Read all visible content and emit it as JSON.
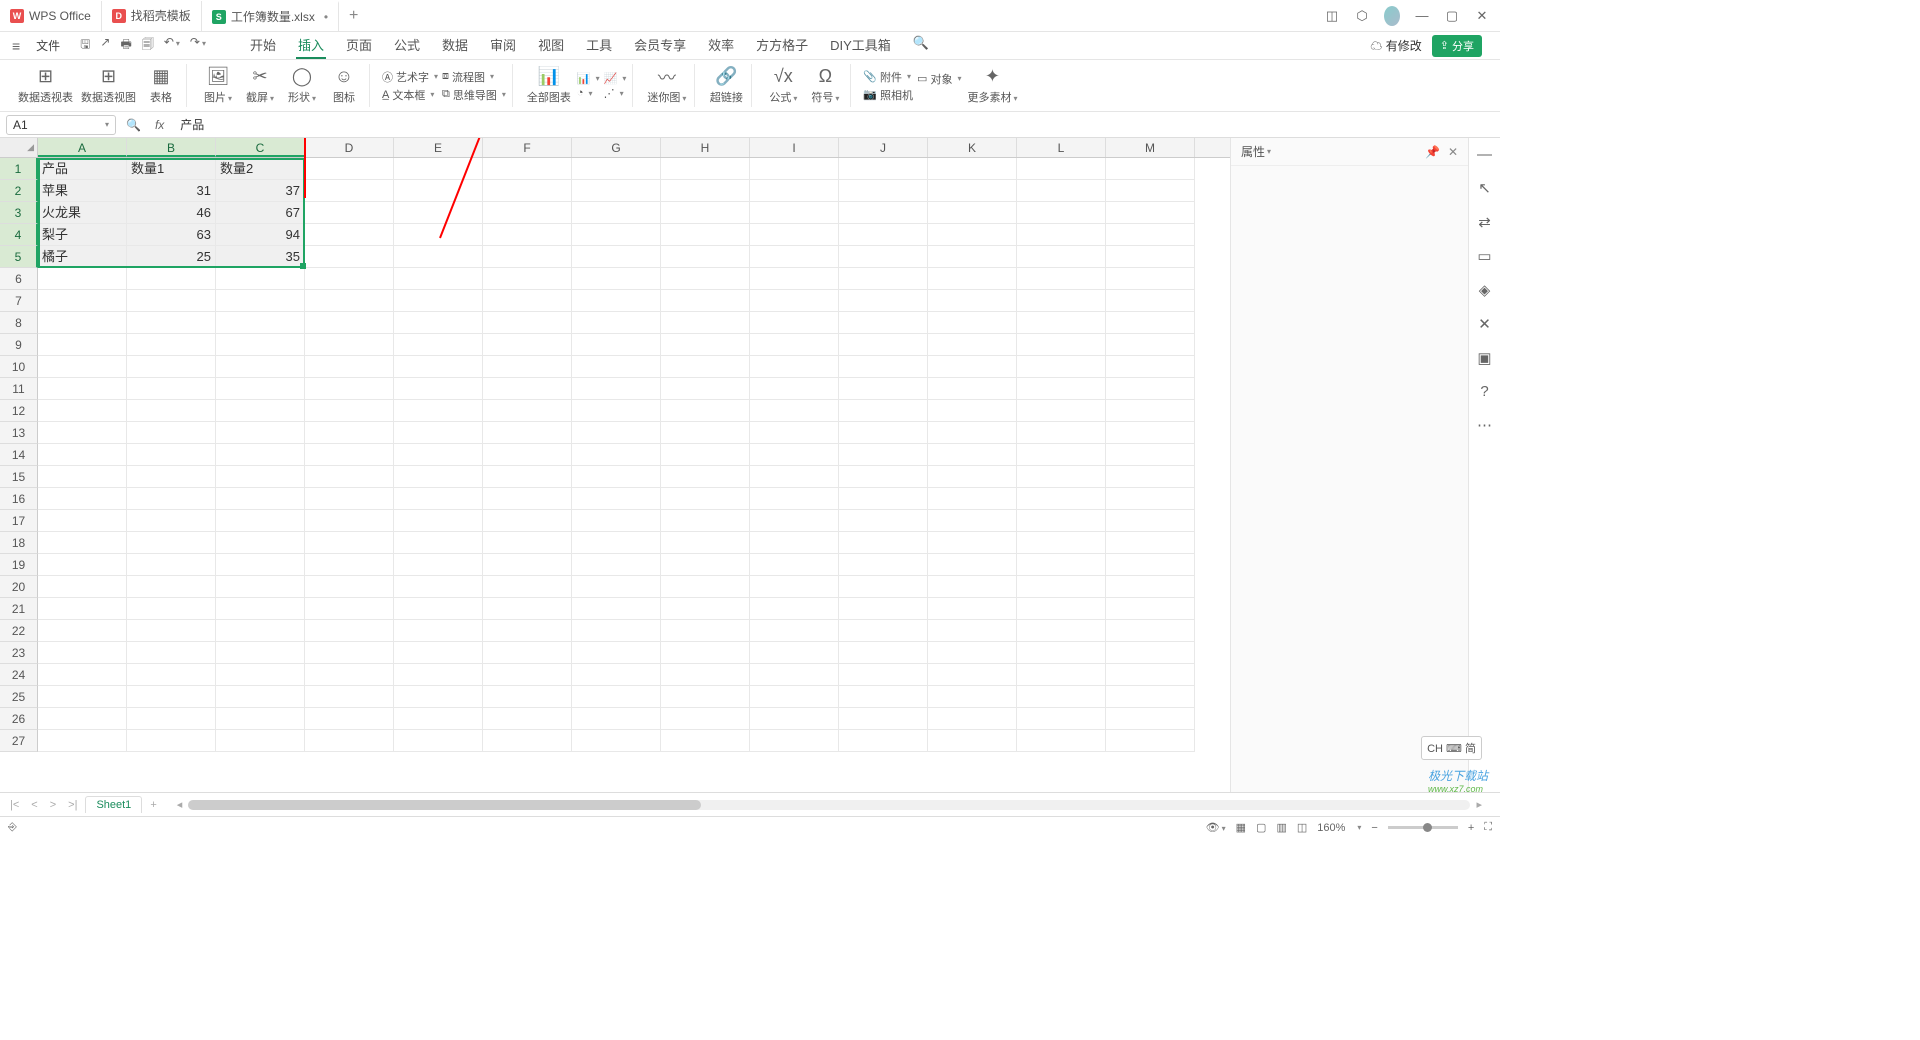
{
  "tabs": [
    {
      "label": "WPS Office",
      "icon": "red"
    },
    {
      "label": "找稻壳模板",
      "icon": "redfill"
    },
    {
      "label": "工作簿数量.xlsx",
      "icon": "green",
      "dirty": "•"
    }
  ],
  "file_menu": "文件",
  "menu_tabs": [
    "开始",
    "插入",
    "页面",
    "公式",
    "数据",
    "审阅",
    "视图",
    "工具",
    "会员专享",
    "效率",
    "方方格子",
    "DIY工具箱"
  ],
  "menu_active_index": 1,
  "header_right": {
    "revise": "有修改",
    "share": "分享"
  },
  "ribbon": {
    "g1": [
      "数据透视表",
      "数据透视图",
      "表格"
    ],
    "g2": [
      "图片",
      "截屏",
      "形状",
      "图标"
    ],
    "g3": {
      "art": "艺术字",
      "flow": "流程图",
      "textbox": "文本框",
      "mind": "思维导图"
    },
    "g4": {
      "all": "全部图表"
    },
    "g5": "迷你图",
    "g6": "超链接",
    "g7": [
      "公式",
      "符号"
    ],
    "g8": {
      "attach": "附件",
      "object": "对象",
      "camera": "照相机",
      "more": "更多素材"
    }
  },
  "namebox": "A1",
  "formula_value": "产品",
  "columns": [
    "A",
    "B",
    "C",
    "D",
    "E",
    "F",
    "G",
    "H",
    "I",
    "J",
    "K",
    "L",
    "M"
  ],
  "sel_cols": 3,
  "row_count": 27,
  "sel_rows": 5,
  "data": {
    "headers": [
      "产品",
      "数量1",
      "数量2"
    ],
    "rows": [
      [
        "苹果",
        "31",
        "37"
      ],
      [
        "火龙果",
        "46",
        "67"
      ],
      [
        "梨子",
        "63",
        "94"
      ],
      [
        "橘子",
        "25",
        "35"
      ]
    ]
  },
  "sidepanel": {
    "title": "属性"
  },
  "sheet_tab": "Sheet1",
  "status": {
    "zoom": "160%"
  },
  "ime": "CH ⌨ 简",
  "watermark": {
    "t1": "极光下载站",
    "t2": "www.xz7.com"
  }
}
